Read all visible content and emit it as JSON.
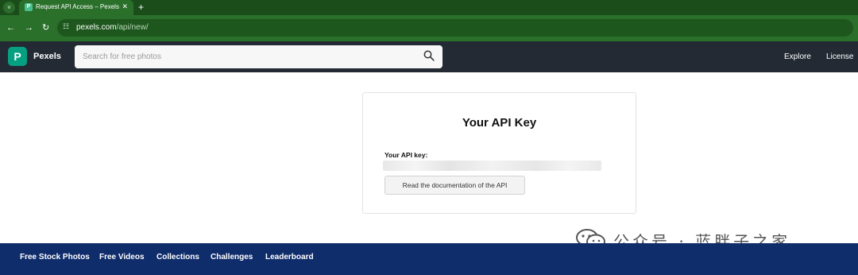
{
  "browser": {
    "tab_title": "Request API Access – Pexels",
    "tab_favicon": "P",
    "tab_close": "✕",
    "new_tab": "+",
    "tab_search": "˅",
    "back": "←",
    "forward": "→",
    "reload": "↻",
    "site_info": "☷",
    "url_host": "pexels.com",
    "url_path": "/api/new/"
  },
  "header": {
    "logo_mark": "P",
    "logo_text": "Pexels",
    "search_placeholder": "Search for free photos",
    "nav": [
      "Explore",
      "License"
    ]
  },
  "card": {
    "title": "Your API Key",
    "key_label": "Your API key:",
    "doc_button": "Read the documentation of the API"
  },
  "footer": {
    "links": [
      "Free Stock Photos",
      "Free Videos",
      "Collections",
      "Challenges",
      "Leaderboard"
    ]
  },
  "watermark": {
    "text": "公众号 · 蓝胖子之家"
  },
  "colors": {
    "tab_strip": "#1b4d1b",
    "toolbar": "#2a6f2a",
    "header": "#232a34",
    "brand": "#05a081",
    "footer": "#0f2c6b"
  }
}
